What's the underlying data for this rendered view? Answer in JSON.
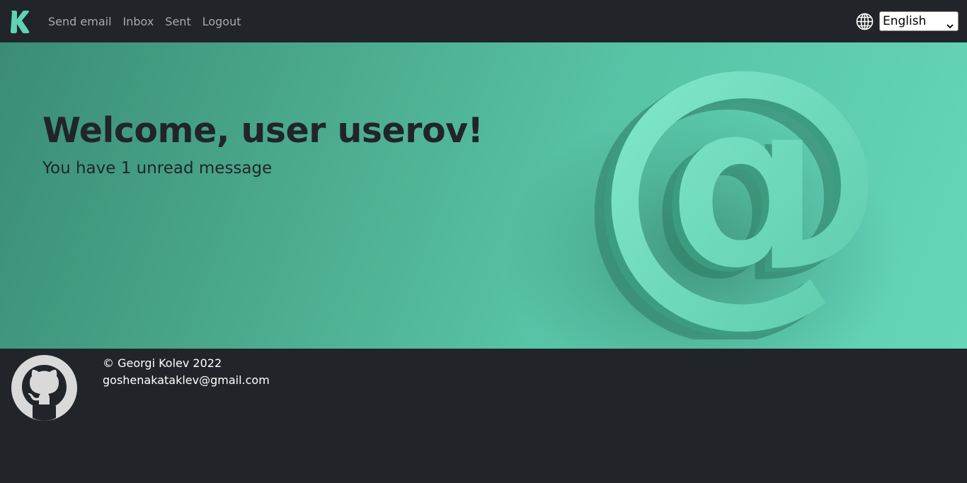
{
  "navbar": {
    "brand_icon": "k-logo-icon",
    "links": [
      {
        "label": "Send email"
      },
      {
        "label": "Inbox"
      },
      {
        "label": "Sent"
      },
      {
        "label": "Logout"
      }
    ],
    "globe_icon": "globe-icon",
    "language": {
      "selected": "English"
    }
  },
  "hero": {
    "title": "Welcome, user userov!",
    "subtitle": "You have 1 unread message",
    "image_icon": "at-sign-icon"
  },
  "footer": {
    "github_icon": "github-icon",
    "copyright": "© Georgi Kolev 2022",
    "email": "goshenakataklev@gmail.com"
  },
  "colors": {
    "navbar_bg": "#212529",
    "brand_accent": "#5fd3b3",
    "hero_text": "#212529"
  }
}
